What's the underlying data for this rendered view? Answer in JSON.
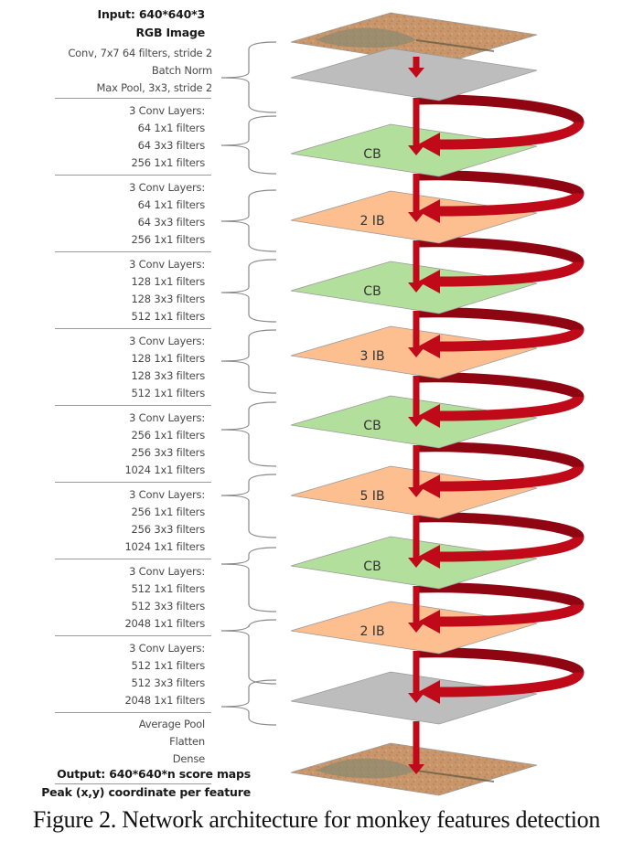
{
  "figure": {
    "caption": "Figure 2. Network architecture for monkey features detection",
    "input": {
      "line1": "Input: 640*640*3",
      "line2": "RGB Image"
    },
    "output": {
      "line1": "Output: 640*640*n score maps",
      "line2": "Peak (x,y) coordinate per feature"
    },
    "colors": {
      "arrow": "#c00a1a",
      "arrow_dark": "#8f0612",
      "cb_plane": "#b3df9c",
      "ib_plane": "#fdbf8f",
      "gray_plane": "#bebdbe",
      "image_plane": "#c89566"
    },
    "label_groups": [
      {
        "lines": [
          "Conv, 7x7 64 filters, stride 2",
          "Batch Norm",
          "Max Pool, 3x3, stride 2"
        ]
      },
      {
        "lines": [
          "3 Conv Layers:",
          "64 1x1 filters",
          "64 3x3 filters",
          "256 1x1 filters"
        ]
      },
      {
        "lines": [
          "3 Conv Layers:",
          "64 1x1 filters",
          "64 3x3 filters",
          "256 1x1 filters"
        ]
      },
      {
        "lines": [
          "3 Conv Layers:",
          "128 1x1 filters",
          "128 3x3 filters",
          "512 1x1 filters"
        ]
      },
      {
        "lines": [
          "3 Conv Layers:",
          "128 1x1 filters",
          "128 3x3 filters",
          "512 1x1 filters"
        ]
      },
      {
        "lines": [
          "3 Conv Layers:",
          "256 1x1 filters",
          "256 3x3 filters",
          "1024 1x1 filters"
        ]
      },
      {
        "lines": [
          "3 Conv Layers:",
          "256 1x1 filters",
          "256 3x3 filters",
          "1024 1x1 filters"
        ]
      },
      {
        "lines": [
          "3 Conv Layers:",
          "512 1x1 filters",
          "512 3x3 filters",
          "2048 1x1 filters"
        ]
      },
      {
        "lines": [
          "3 Conv Layers:",
          "512 1x1 filters",
          "512 3x3 filters",
          "2048 1x1 filters"
        ]
      },
      {
        "lines": [
          "Average Pool",
          "Flatten",
          "Dense"
        ]
      }
    ],
    "planes": [
      {
        "kind": "image",
        "label": ""
      },
      {
        "kind": "gray",
        "label": ""
      },
      {
        "kind": "cb",
        "label": "CB"
      },
      {
        "kind": "ib",
        "label": "2 IB"
      },
      {
        "kind": "cb",
        "label": "CB"
      },
      {
        "kind": "ib",
        "label": "3 IB"
      },
      {
        "kind": "cb",
        "label": "CB"
      },
      {
        "kind": "ib",
        "label": "5 IB"
      },
      {
        "kind": "cb",
        "label": "CB"
      },
      {
        "kind": "ib",
        "label": "2 IB"
      },
      {
        "kind": "gray",
        "label": ""
      },
      {
        "kind": "image",
        "label": ""
      }
    ]
  }
}
